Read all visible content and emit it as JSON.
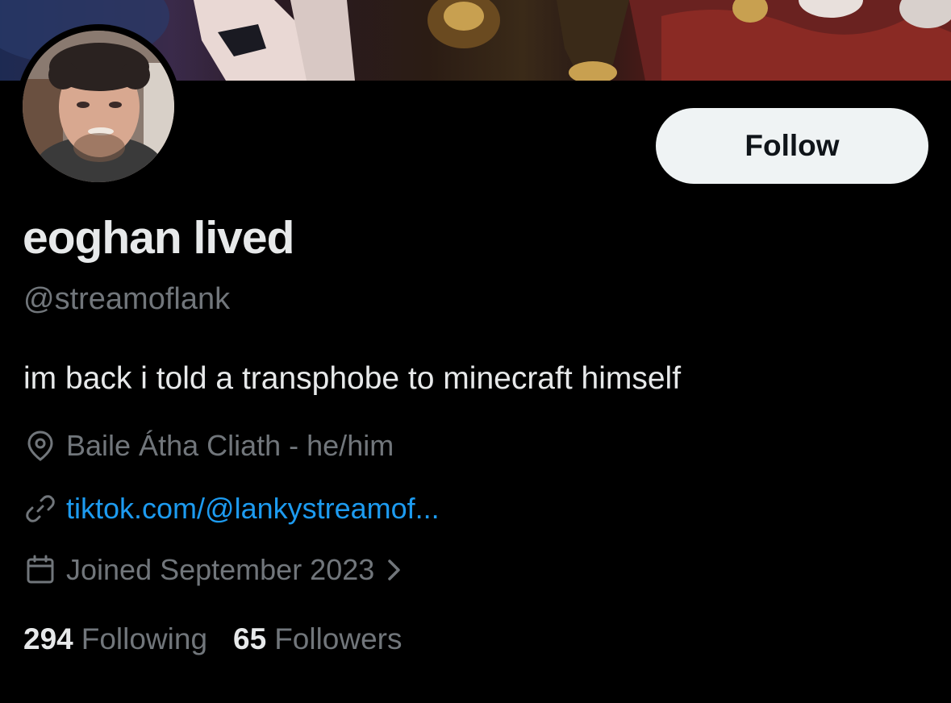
{
  "profile": {
    "display_name": "eoghan lived",
    "handle": "@streamoflank",
    "bio": "im back i told a transphobe to minecraft himself",
    "location": "Baile Átha Cliath - he/him",
    "website": "tiktok.com/@lankystreamof...",
    "joined": "Joined September 2023"
  },
  "actions": {
    "follow_label": "Follow"
  },
  "stats": {
    "following_count": "294",
    "following_label": "Following",
    "followers_count": "65",
    "followers_label": "Followers"
  },
  "icons": {
    "location": "location-pin-icon",
    "link": "link-icon",
    "calendar": "calendar-icon",
    "chevron": "chevron-right-icon"
  },
  "colors": {
    "background": "#000000",
    "primary_text": "#e7e9ea",
    "secondary_text": "#71767b",
    "link": "#1d9bf0",
    "button_bg": "#eff3f4"
  }
}
